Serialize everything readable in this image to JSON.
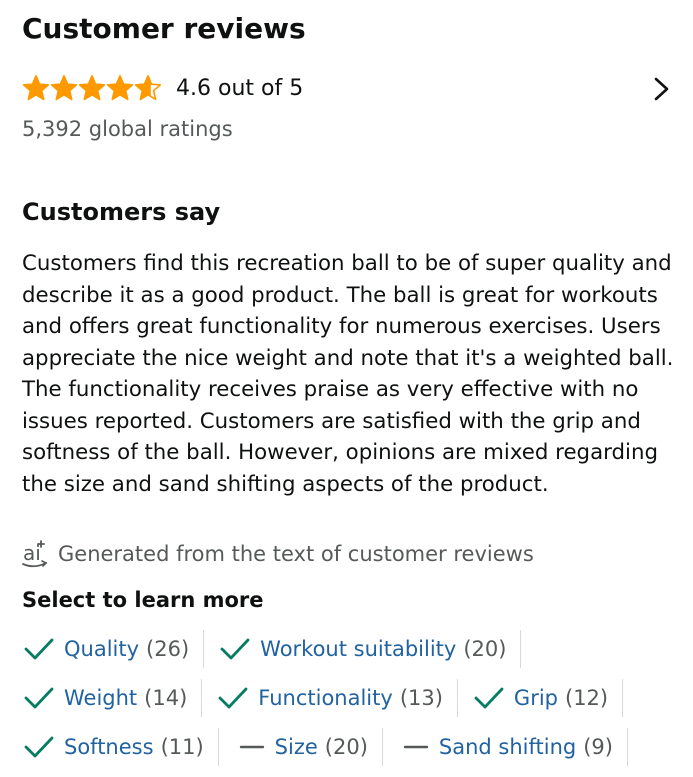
{
  "header": {
    "title": "Customer reviews",
    "rating_text": "4.6 out of 5",
    "rating_value": 4.6,
    "global_ratings": "5,392 global ratings"
  },
  "summary": {
    "heading": "Customers say",
    "text": "Customers find this recreation ball to be of super quality and describe it as a good product. The ball is great for workouts and offers great functionality for numerous exercises. Users appreciate the nice weight and note that it's a weighted ball. The functionality receives praise as very effective with no issues reported. Customers are satisfied with the grip and softness of the ball. However, opinions are mixed regarding the size and sand shifting aspects of the product.",
    "ai_note": "Generated from the text of customer reviews"
  },
  "learn_more": {
    "heading": "Select to learn more",
    "rows": [
      [
        {
          "label": "Quality",
          "count": "(26)",
          "sentiment": "positive"
        },
        {
          "label": "Workout suitability",
          "count": "(20)",
          "sentiment": "positive"
        }
      ],
      [
        {
          "label": "Weight",
          "count": "(14)",
          "sentiment": "positive"
        },
        {
          "label": "Functionality",
          "count": "(13)",
          "sentiment": "positive"
        },
        {
          "label": "Grip",
          "count": "(12)",
          "sentiment": "positive"
        }
      ],
      [
        {
          "label": "Softness",
          "count": "(11)",
          "sentiment": "positive"
        },
        {
          "label": "Size",
          "count": "(20)",
          "sentiment": "mixed"
        },
        {
          "label": "Sand shifting",
          "count": "(9)",
          "sentiment": "mixed"
        }
      ]
    ]
  },
  "colors": {
    "star": "#ff9900",
    "link": "#2162a1",
    "check": "#067d62",
    "secondary_text": "#565959"
  },
  "icons": {
    "star": "star-icon",
    "chevron": "chevron-right-icon",
    "ai": "ai-generated-icon",
    "positive": "check-icon",
    "mixed": "dash-icon"
  }
}
